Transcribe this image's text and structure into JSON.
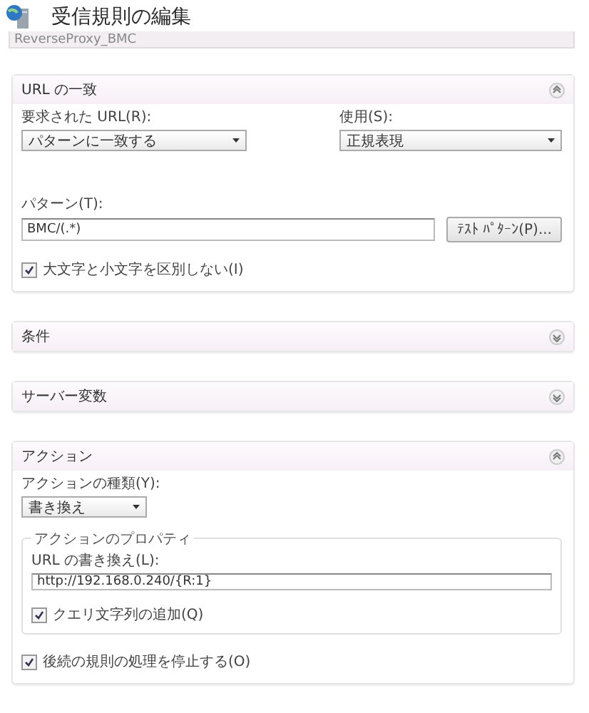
{
  "title": "受信規則の編集",
  "rule_name": "ReverseProxy_BMC",
  "match_url": {
    "title": "URL の一致",
    "expanded": true,
    "requested_url_label": "要求された URL(R):",
    "requested_url_value": "パターンに一致する",
    "using_label": "使用(S):",
    "using_value": "正規表現",
    "pattern_label": "パターン(T):",
    "pattern_value": "BMC/(.*)",
    "test_button": "ﾃｽﾄ ﾊﾟﾀｰﾝ(P)...",
    "ignore_case": {
      "label": "大文字と小文字を区別しない(I)",
      "checked": true
    }
  },
  "conditions": {
    "title": "条件",
    "expanded": false
  },
  "server_variables": {
    "title": "サーバー変数",
    "expanded": false
  },
  "action": {
    "title": "アクション",
    "expanded": true,
    "type_label": "アクションの種類(Y):",
    "type_value": "書き換え",
    "properties_title": "アクションのプロパティ",
    "rewrite_url_label": "URL の書き換え(L):",
    "rewrite_url_value": "http://192.168.0.240/{R:1}",
    "append_query": {
      "label": "クエリ文字列の追加(Q)",
      "checked": true
    },
    "stop_processing": {
      "label": "後続の規則の処理を停止する(O)",
      "checked": true
    }
  }
}
